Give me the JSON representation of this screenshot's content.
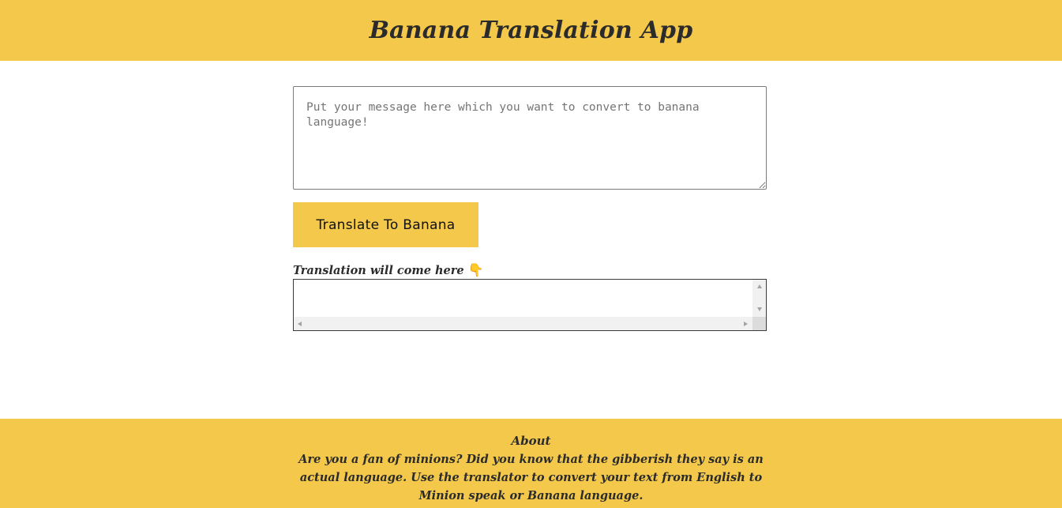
{
  "header": {
    "title": "Banana Translation App"
  },
  "input": {
    "placeholder": "Put your message here which you want to convert to banana language!",
    "value": ""
  },
  "translate_button": {
    "label": "Translate To Banana"
  },
  "output": {
    "label": "Translation will come here",
    "icon": "pointing-down-icon",
    "value": ""
  },
  "footer": {
    "heading": "About",
    "text": "Are you a fan of minions? Did you know that the gibberish they say is an actual language. Use the translator to convert your text from English to Minion speak or Banana language."
  },
  "colors": {
    "accent": "#f3c84b",
    "text": "#2b2b2b",
    "background": "#ffffff"
  }
}
